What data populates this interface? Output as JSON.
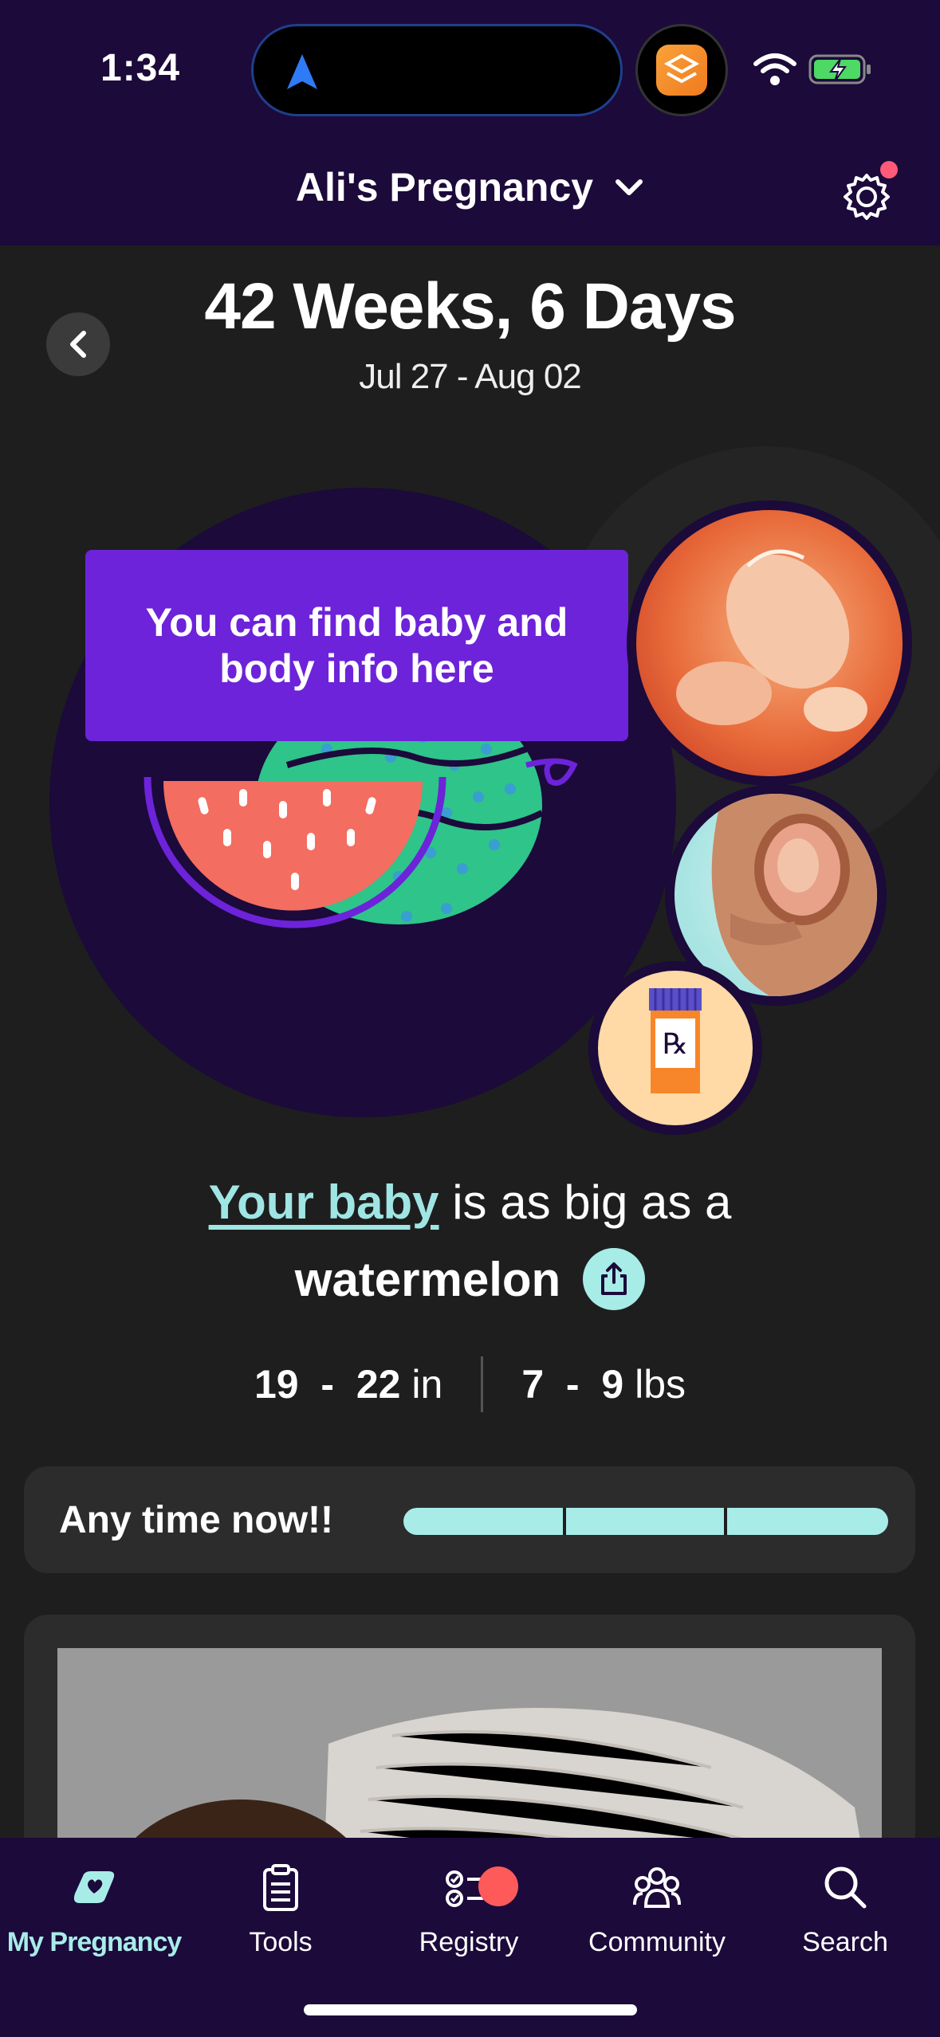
{
  "status_bar": {
    "time": "1:34"
  },
  "header": {
    "title": "Ali's Pregnancy",
    "settings_has_notification": true
  },
  "week": {
    "title": "42 Weeks, 6 Days",
    "range": "Jul 27 - Aug 02"
  },
  "tooltip": {
    "text": "You can find baby and body info here"
  },
  "hero": {
    "fruit_icon": "watermelon-illustration",
    "circles": [
      "baby-development-image",
      "body-changes-image",
      "rx-bottle-icon"
    ]
  },
  "size": {
    "link": "Your baby",
    "suffix": " is as big as a",
    "fruit": "watermelon"
  },
  "measurements": {
    "length_min": "19",
    "length_sep": "-",
    "length_max": "22",
    "length_unit": "in",
    "weight_min": "7",
    "weight_sep": "-",
    "weight_max": "9",
    "weight_unit": "lbs"
  },
  "progress": {
    "label": "Any time now!!",
    "fraction": 1.0,
    "color": "#a8ece8"
  },
  "tabs": [
    {
      "label": "My Pregnancy",
      "icon": "pregnancy-icon",
      "active": true
    },
    {
      "label": "Tools",
      "icon": "clipboard-icon",
      "active": false
    },
    {
      "label": "Registry",
      "icon": "checklist-icon",
      "active": false
    },
    {
      "label": "Community",
      "icon": "people-icon",
      "active": false
    },
    {
      "label": "Search",
      "icon": "search-icon",
      "active": false
    }
  ],
  "colors": {
    "header_bg": "#1b0a3a",
    "accent": "#a8ece8",
    "tooltip": "#6d23d9",
    "page_bg": "#1e1e1e"
  }
}
